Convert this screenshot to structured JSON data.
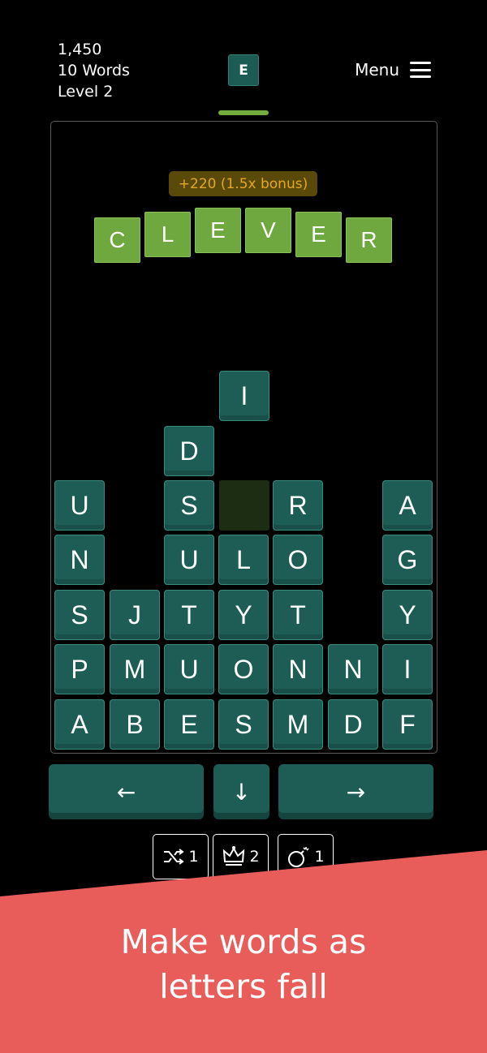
{
  "stats": {
    "score": "1,450",
    "words": "10 Words",
    "level": "Level 2"
  },
  "next_tile": "E",
  "menu_label": "Menu",
  "bonus_text": "+220 (1.5x bonus)",
  "word": [
    "C",
    "L",
    "E",
    "V",
    "E",
    "R"
  ],
  "falling_tile": "I",
  "grid": {
    "rows": [
      [
        "",
        "",
        "D",
        "",
        "",
        "",
        ""
      ],
      [
        "U",
        "",
        "S",
        "",
        "R",
        "",
        "A"
      ],
      [
        "N",
        "",
        "U",
        "L",
        "O",
        "",
        "G"
      ],
      [
        "S",
        "J",
        "T",
        "Y",
        "T",
        "",
        "Y"
      ],
      [
        "P",
        "M",
        "U",
        "O",
        "N",
        "N",
        "I"
      ],
      [
        "A",
        "B",
        "E",
        "S",
        "M",
        "D",
        "F"
      ]
    ]
  },
  "controls": {
    "left": "←",
    "down": "↓",
    "right": "→"
  },
  "powerups": [
    {
      "icon": "shuffle-icon",
      "count": "1"
    },
    {
      "icon": "crown-icon",
      "count": "2"
    },
    {
      "icon": "bomb-icon",
      "count": "1"
    }
  ],
  "caption": [
    "Make words as",
    "letters fall"
  ],
  "colors": {
    "tile": "#1e5d56",
    "word_tile": "#6ea83f",
    "bonus": "#e4a826",
    "banner": "#e85c5a",
    "accent_bar": "#72ad3e"
  }
}
